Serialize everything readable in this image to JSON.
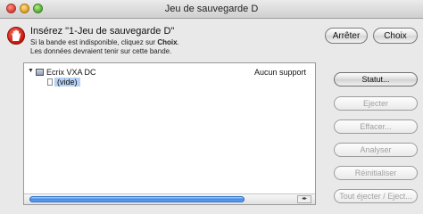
{
  "window": {
    "title": "Jeu de sauvegarde D"
  },
  "message": {
    "title": "Insérez \"1-Jeu de sauvegarde D\"",
    "line1_prefix": "Si la bande est indisponible, cliquez sur ",
    "line1_bold": "Choix",
    "line1_suffix": ".",
    "line2": "Les données devraient tenir sur cette bande."
  },
  "top_buttons": {
    "stop": "Arrêter",
    "choice": "Choix"
  },
  "tree": {
    "drive": {
      "label": "Ecrix VXA DC",
      "support": "Aucun support"
    },
    "child": {
      "label": "(vide)"
    }
  },
  "progress": {
    "fill_fraction": 0.82
  },
  "side_buttons": [
    {
      "label": "Statut...",
      "enabled": true
    },
    {
      "label": "Ejecter",
      "enabled": false
    },
    {
      "label": "Effacer...",
      "enabled": false
    },
    {
      "label": "Analyser",
      "enabled": false
    },
    {
      "label": "Réinitialiser",
      "enabled": false
    },
    {
      "label": "Tout éjecter / Eject...",
      "enabled": false
    }
  ],
  "icons": {
    "close": "close-icon",
    "minimize": "minimize-icon",
    "zoom": "zoom-icon",
    "alert": "stop-hand-icon",
    "drive": "tape-drive-icon",
    "media": "document-icon",
    "disclosure": "disclosure-triangle-icon"
  }
}
